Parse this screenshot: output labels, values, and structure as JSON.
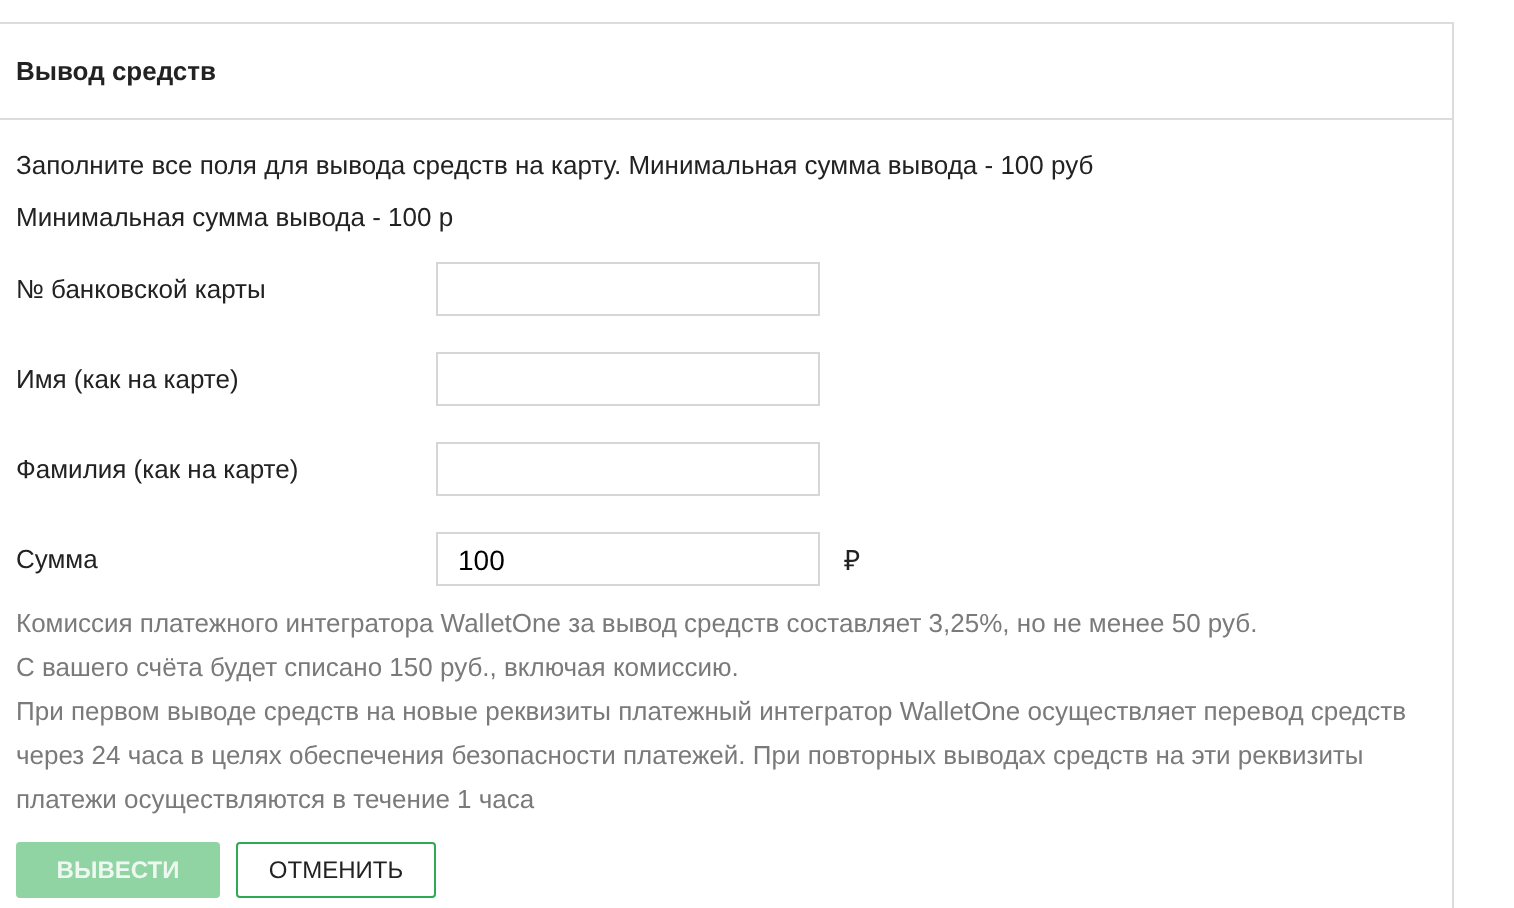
{
  "panel": {
    "title": "Вывод средств"
  },
  "intro": [
    "Заполните все поля для вывода средств на карту. Минимальная сумма вывода - 100 руб",
    "Минимальная сумма вывода - 100 р"
  ],
  "fields": [
    {
      "label": "№ банковской карты"
    },
    {
      "label": "Имя (как на карте)"
    },
    {
      "label": "Фамилия (как на карте)"
    },
    {
      "label": "Сумма",
      "value": "100",
      "suffix": "₽"
    }
  ],
  "notes": [
    "Комиссия платежного интегратора WalletOne за вывод средств составляет 3,25%, но не менее 50 руб.",
    "С вашего счёта будет списано 150 руб., включая комиссию.",
    "При первом выводе средств на новые реквизиты платежный интегратор WalletOne осуществляет перевод средств через 24 часа в целях обеспечения безопасности платежей. При повторных выводах средств на эти реквизиты платежи осуществляются в течение 1 часа"
  ],
  "buttons": [
    {
      "label": "ВЫВЕСТИ",
      "kind": "primary",
      "disabled": true
    },
    {
      "label": "ОТМЕНИТЬ",
      "kind": "secondary",
      "disabled": false
    }
  ]
}
